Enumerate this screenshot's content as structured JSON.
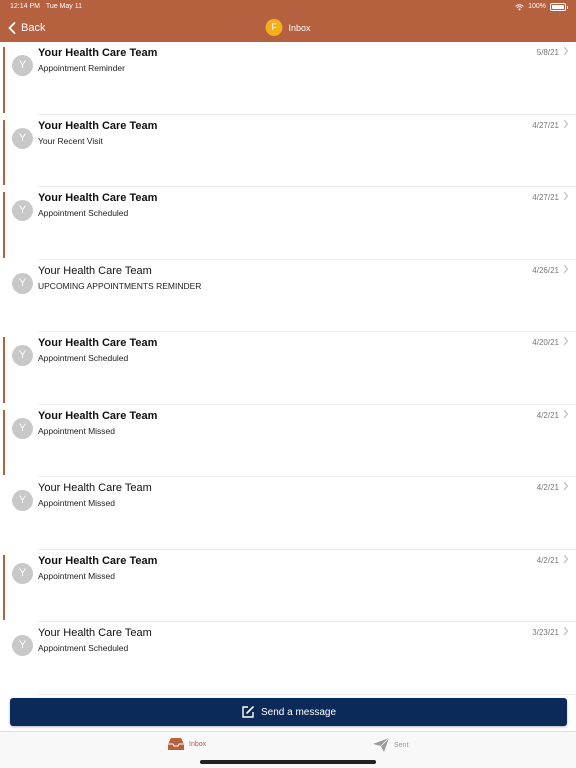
{
  "status_bar": {
    "time": "12:14 PM",
    "date": "Tue May 11",
    "battery": "100%"
  },
  "nav": {
    "back_label": "Back",
    "badge_letter": "F",
    "title": "Inbox"
  },
  "messages": [
    {
      "avatar": "Y",
      "sender": "Your Health Care Team",
      "subject": "Appointment Reminder",
      "date": "5/8/21",
      "unread": true
    },
    {
      "avatar": "Y",
      "sender": "Your Health Care Team",
      "subject": "Your Recent Visit",
      "date": "4/27/21",
      "unread": true
    },
    {
      "avatar": "Y",
      "sender": "Your Health Care Team",
      "subject": "Appointment Scheduled",
      "date": "4/27/21",
      "unread": true
    },
    {
      "avatar": "Y",
      "sender": "Your Health Care Team",
      "subject": "UPCOMING APPOINTMENTS REMINDER",
      "date": "4/26/21",
      "unread": false
    },
    {
      "avatar": "Y",
      "sender": "Your Health Care Team",
      "subject": "Appointment Scheduled",
      "date": "4/20/21",
      "unread": true
    },
    {
      "avatar": "Y",
      "sender": "Your Health Care Team",
      "subject": "Appointment Missed",
      "date": "4/2/21",
      "unread": true
    },
    {
      "avatar": "Y",
      "sender": "Your Health Care Team",
      "subject": "Appointment Missed",
      "date": "4/2/21",
      "unread": false
    },
    {
      "avatar": "Y",
      "sender": "Your Health Care Team",
      "subject": "Appointment Missed",
      "date": "4/2/21",
      "unread": true
    },
    {
      "avatar": "Y",
      "sender": "Your Health Care Team",
      "subject": "Appointment Scheduled",
      "date": "3/23/21",
      "unread": false
    }
  ],
  "send_button": {
    "label": "Send a message"
  },
  "tabs": [
    {
      "label": "Inbox",
      "icon": "inbox-icon",
      "active": true
    },
    {
      "label": "Sent",
      "icon": "paper-plane-icon",
      "active": false
    }
  ],
  "colors": {
    "header": "#b5603f",
    "accent": "#b5603f",
    "badge": "#f3b01c",
    "send_button": "#0b2a5a",
    "avatar": "#c8c8c8"
  }
}
